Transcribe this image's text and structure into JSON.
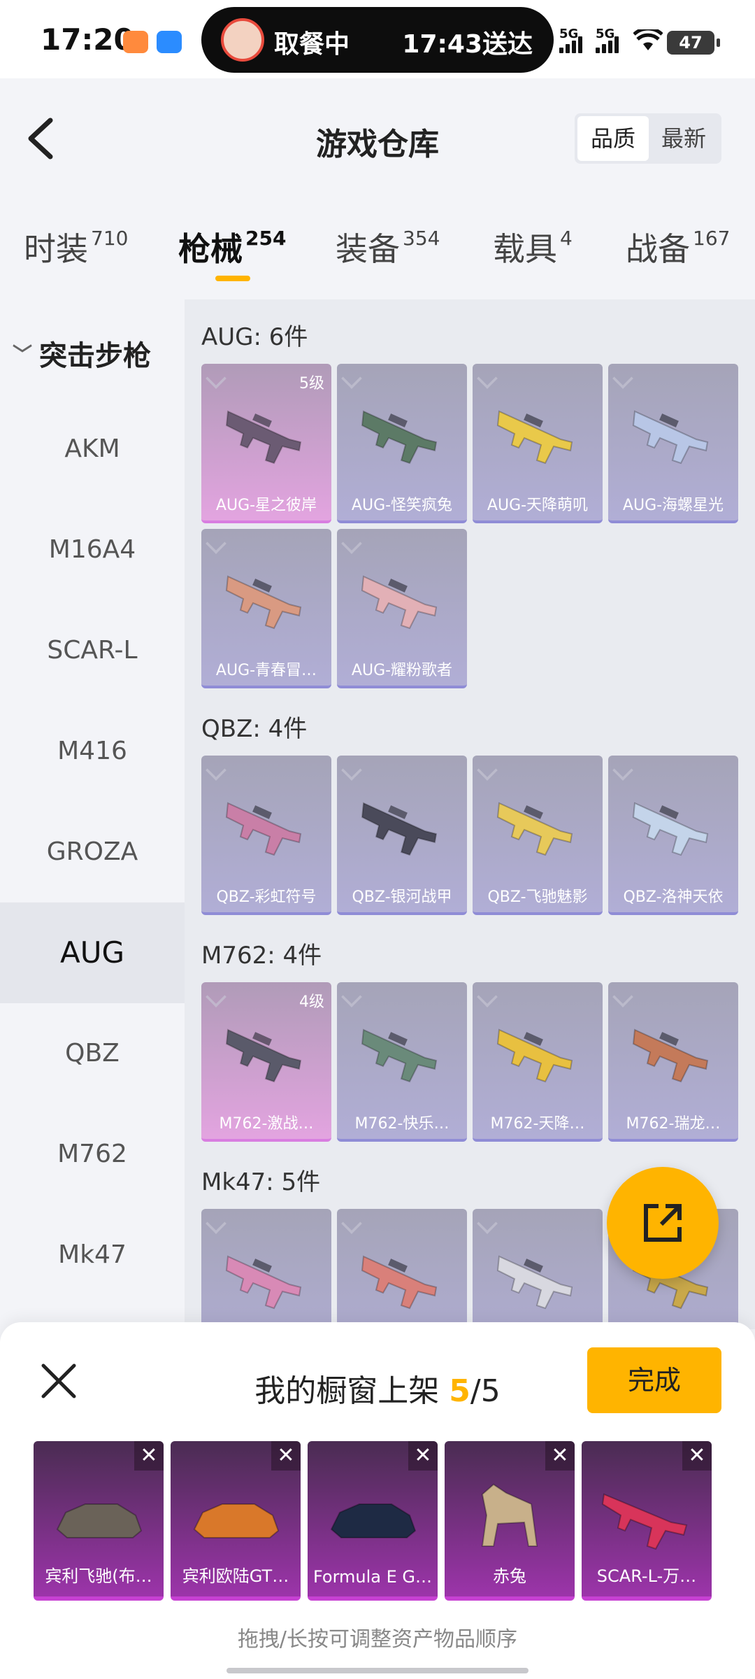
{
  "status_bar": {
    "time": "17:20",
    "pill_left": "取餐中",
    "pill_right": "17:43送达",
    "network1": "5G",
    "network2": "5G",
    "battery": "47"
  },
  "header": {
    "title": "游戏仓库",
    "sort_options": [
      "品质",
      "最新"
    ],
    "sort_selected": "品质"
  },
  "tabs": [
    {
      "label": "时装",
      "count": "710"
    },
    {
      "label": "枪械",
      "count": "254",
      "active": true
    },
    {
      "label": "装备",
      "count": "354"
    },
    {
      "label": "载具",
      "count": "4"
    },
    {
      "label": "战备",
      "count": "167"
    }
  ],
  "sidebar": {
    "group": "突击步枪",
    "items": [
      "AKM",
      "M16A4",
      "SCAR-L",
      "M416",
      "GROZA",
      "AUG",
      "QBZ",
      "M762",
      "Mk47"
    ],
    "active": "AUG"
  },
  "sections": [
    {
      "title": "AUG: 6件",
      "items": [
        {
          "name": "AUG-星之彼岸",
          "level": "5级",
          "highlight": true,
          "color": "#6b5b73"
        },
        {
          "name": "AUG-怪笑疯兔",
          "color": "#5c7a66"
        },
        {
          "name": "AUG-天降萌叽",
          "color": "#e9c94a"
        },
        {
          "name": "AUG-海螺星光",
          "color": "#b8c6e6"
        },
        {
          "name": "AUG-青春冒…",
          "color": "#d99a82"
        },
        {
          "name": "AUG-耀粉歌者",
          "color": "#e2b0b6"
        }
      ]
    },
    {
      "title": "QBZ: 4件",
      "items": [
        {
          "name": "QBZ-彩虹符号",
          "color": "#c97fa7"
        },
        {
          "name": "QBZ-银河战甲",
          "color": "#4a4a5a"
        },
        {
          "name": "QBZ-飞驰魅影",
          "color": "#e7c95a"
        },
        {
          "name": "QBZ-洛神天依",
          "color": "#c4d4ea"
        }
      ]
    },
    {
      "title": "M762: 4件",
      "items": [
        {
          "name": "M762-激战…",
          "level": "4级",
          "highlight": true,
          "color": "#5a5a6a"
        },
        {
          "name": "M762-快乐…",
          "color": "#6a8a7a"
        },
        {
          "name": "M762-天降…",
          "color": "#e8c040"
        },
        {
          "name": "M762-瑞龙…",
          "color": "#c47a5a"
        }
      ]
    },
    {
      "title": "Mk47: 5件",
      "items": [
        {
          "name": "",
          "color": "#d88ab6"
        },
        {
          "name": "",
          "color": "#d9807a"
        },
        {
          "name": "",
          "color": "#d8d8e0"
        },
        {
          "name": "",
          "color": "#c9a84a"
        }
      ]
    }
  ],
  "sheet": {
    "title_prefix": "我的橱窗上架 ",
    "count": "5",
    "total": "/5",
    "done_label": "完成",
    "items": [
      {
        "name": "宾利飞驰(布…",
        "color": "#6a6258"
      },
      {
        "name": "宾利欧陆GT…",
        "color": "#d9782a"
      },
      {
        "name": "Formula E G…",
        "color": "#1e2a44"
      },
      {
        "name": "赤兔",
        "color": "#c8b08a"
      },
      {
        "name": "SCAR-L-万…",
        "color": "#d8345a"
      }
    ],
    "hint": "拖拽/长按可调整资产物品顺序"
  },
  "icons": {
    "back": "back-arrow-icon",
    "fab": "share-export-icon",
    "close": "close-icon",
    "remove": "remove-x-icon"
  }
}
